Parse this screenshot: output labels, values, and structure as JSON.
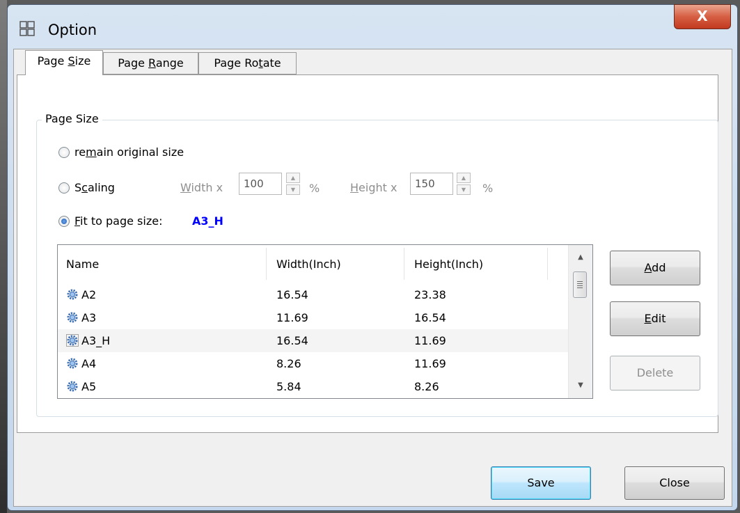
{
  "window": {
    "title": "Option",
    "close_glyph": "X"
  },
  "tabs": [
    {
      "label_pre": "Page ",
      "label_u": "S",
      "label_post": "ize",
      "active": true
    },
    {
      "label_pre": "Page ",
      "label_u": "R",
      "label_post": "ange",
      "active": false
    },
    {
      "label_pre": "Page Ro",
      "label_u": "t",
      "label_post": "ate",
      "active": false
    }
  ],
  "group": {
    "legend": "Page Size",
    "remain": {
      "pre": "re",
      "u": "m",
      "post": "ain original size",
      "checked": false
    },
    "scaling": {
      "pre": "S",
      "u": "c",
      "post": "aling",
      "checked": false
    },
    "width": {
      "u": "W",
      "post": "idth x",
      "value": "100",
      "unit": "%"
    },
    "height": {
      "u": "H",
      "post": "eight x",
      "value": "150",
      "unit": "%"
    },
    "fit": {
      "u": "F",
      "post": "it to page size:",
      "value": "A3_H",
      "value_color": "#0000ff",
      "checked": true
    }
  },
  "table": {
    "columns": [
      "Name",
      "Width(Inch)",
      "Height(Inch)"
    ],
    "rows": [
      {
        "name": "A2",
        "width": "16.54",
        "height": "23.38",
        "selected": false
      },
      {
        "name": "A3",
        "width": "11.69",
        "height": "16.54",
        "selected": false
      },
      {
        "name": "A3_H",
        "width": "16.54",
        "height": "11.69",
        "selected": true
      },
      {
        "name": "A4",
        "width": "8.26",
        "height": "11.69",
        "selected": false
      },
      {
        "name": "A5",
        "width": "5.84",
        "height": "8.26",
        "selected": false
      }
    ],
    "row_icon": "gear-icon"
  },
  "side_buttons": {
    "add": {
      "u": "A",
      "post": "dd"
    },
    "edit": {
      "u": "E",
      "post": "dit"
    },
    "delete": {
      "label": "Delete",
      "disabled": true
    }
  },
  "footer": {
    "save": "Save",
    "close": "Close"
  }
}
